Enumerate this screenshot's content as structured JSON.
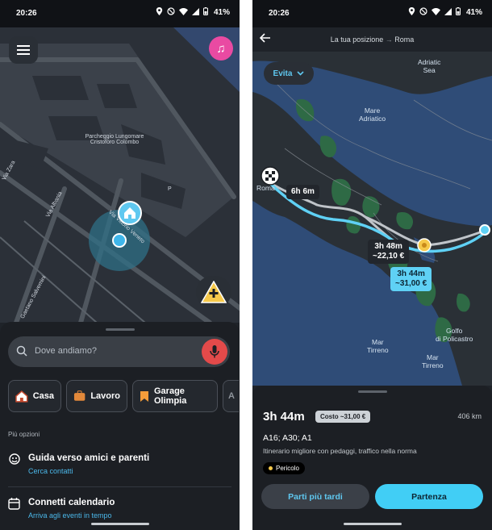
{
  "status_left": {
    "time": "20:26",
    "battery": "41%"
  },
  "status_right": {
    "time": "20:26",
    "battery": "41%"
  },
  "left_map": {
    "labels": {
      "parking": "Parcheggio Lungomare\nCristoforo Colombo",
      "via_zara": "Via Zara",
      "via_albania": "Via Albania",
      "via_vittorio_veneto": "Via Vittorio Veneto",
      "gaetano_salvemini": "Gaetano Salvemini",
      "p_marker": "P"
    }
  },
  "search": {
    "placeholder": "Dove andiamo?"
  },
  "shortcuts": [
    {
      "label": "Casa",
      "icon": "home-icon"
    },
    {
      "label": "Lavoro",
      "icon": "briefcase-icon"
    },
    {
      "label": "Garage\nOlimpia",
      "icon": "bookmark-icon"
    },
    {
      "label": "A"
    }
  ],
  "more_options": {
    "heading": "Più opzioni",
    "items": [
      {
        "title": "Guida verso amici e parenti",
        "subtitle": "Cerca contatti",
        "icon": "friends-icon"
      },
      {
        "title": "Connetti calendario",
        "subtitle": "Arriva agli eventi in tempo",
        "icon": "calendar-icon"
      }
    ]
  },
  "route_header": {
    "origin": "La tua posizione",
    "destination": "Roma"
  },
  "avoid_button": "Evita",
  "right_map": {
    "labels": {
      "adriatic_sea": "Adriatic\nSea",
      "mare_adriatico": "Mare\nAdriatico",
      "roma": "Roma",
      "mar_tirreno_1": "Mar\nTirreno",
      "mar_tirreno_2": "Mar\nTirreno",
      "golfo": "Golfo\ndi Policastro"
    },
    "route_bubbles": [
      {
        "time": "6h 6m",
        "cost": ""
      },
      {
        "time": "3h 48m",
        "cost": "~22,10 €"
      },
      {
        "time": "3h 44m",
        "cost": "~31,00 €"
      }
    ]
  },
  "route_summary": {
    "eta": "3h 44m",
    "cost": "Costo ~31,00 €",
    "distance": "406 km",
    "roads": "A16; A30; A1",
    "description": "Itinerario migliore con pedaggi, traffico nella norma",
    "hazard": "Pericolo"
  },
  "actions": {
    "later": "Parti più tardi",
    "go": "Partenza"
  },
  "colors": {
    "accent": "#41cef5",
    "mic": "#e34a4a",
    "music": "#e94aa2",
    "hazard": "#f6c94b"
  }
}
